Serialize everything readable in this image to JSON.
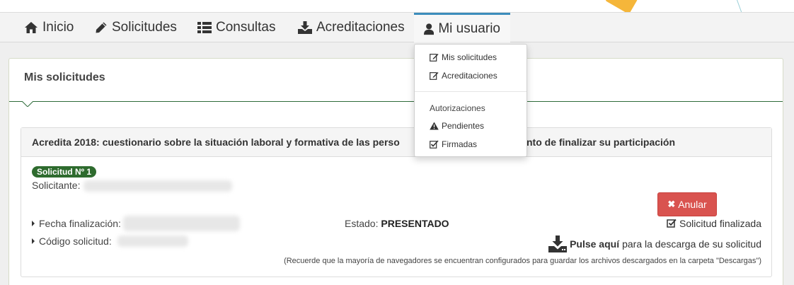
{
  "nav": {
    "items": [
      {
        "label": "Inicio",
        "icon": "home-icon"
      },
      {
        "label": "Solicitudes",
        "icon": "pencil-icon"
      },
      {
        "label": "Consultas",
        "icon": "list-icon"
      },
      {
        "label": "Acreditaciones",
        "icon": "download-icon"
      },
      {
        "label": "Mi usuario",
        "icon": "user-icon"
      }
    ],
    "active": "Mi usuario"
  },
  "dropdown": {
    "items": [
      {
        "label": "Mis solicitudes",
        "icon": "edit-icon"
      },
      {
        "label": "Acreditaciones",
        "icon": "edit-icon"
      }
    ],
    "section_header": "Autorizaciones",
    "section_items": [
      {
        "label": "Pendientes",
        "icon": "warning-icon"
      },
      {
        "label": "Firmadas",
        "icon": "check-square-icon"
      }
    ]
  },
  "panel": {
    "title": "Mis solicitudes"
  },
  "card": {
    "header": "Acredita 2018: cuestionario sobre la situación laboral y formativa de las personas … momento de finalizar su participación",
    "header_left": "Acredita 2018: cuestionario sobre la situación laboral y formativa de las perso",
    "header_right": "momento de finalizar su participación",
    "badge": "Solicitud Nº 1",
    "solicitante_label": "Solicitante:",
    "fecha_label": "Fecha finalización:",
    "codigo_label": "Código solicitud:",
    "estado_label": "Estado:",
    "estado_value": "PRESENTADO",
    "anular_label": "Anular",
    "finalizada_label": "Solicitud finalizada",
    "download_bold": "Pulse aquí",
    "download_rest": "para la descarga de su solicitud",
    "note": "(Recuerde que la mayoría de navegadores se encuentran configurados para guardar los archivos descargados en la carpeta \"Descargas\")"
  },
  "colors": {
    "accent": "#3c8dbc",
    "badge_green": "#2e6b2e",
    "danger": "#d9534f",
    "separator_green": "#2e6b3a"
  }
}
